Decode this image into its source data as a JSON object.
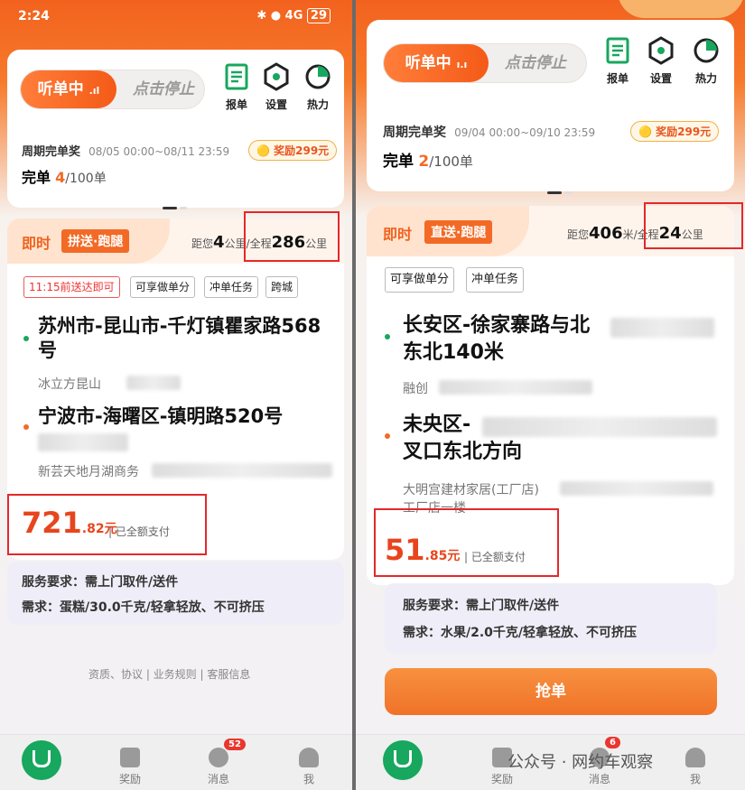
{
  "status": {
    "time": "2:24",
    "battery": "29",
    "signal": "4G"
  },
  "left": {
    "toggle": {
      "on": "听单中",
      "off": "点击停止"
    },
    "tools": [
      {
        "label": "报单",
        "icon": "report-icon"
      },
      {
        "label": "设置",
        "icon": "settings-icon"
      },
      {
        "label": "热力",
        "icon": "heatmap-icon"
      }
    ],
    "period": {
      "label": "周期完单奖",
      "range": "08/05 00:00~08/11 23:59",
      "reward": "奖励299元",
      "done_label": "完单",
      "done": "4",
      "total": "/100单"
    },
    "order": {
      "now": "即时",
      "type": "拼送·跑腿",
      "dist_prefix": "距您",
      "dist_you": "4",
      "dist_unit1": "公里/全程",
      "dist_total": "286",
      "dist_unit2": "公里",
      "tags": [
        "11:15前送达即可",
        "可享做单分",
        "冲单任务",
        "跨城"
      ],
      "from": "苏州市-昆山市-千灯镇瞿家路568号",
      "from_sub": "冰立方昆山",
      "to": "宁波市-海曙区-镇明路520号",
      "to_sub": "新芸天地月湖商务",
      "price_int": "721",
      "price_dec": ".82元",
      "paid": "已全额支付",
      "req1": "服务要求：需上门取件/送件",
      "req2": "需求：蛋糕/30.0千克/轻拿轻放、不可挤压"
    },
    "footer": "资质、协议 | 业务规则 | 客服信息",
    "tabs": {
      "reward": "奖励",
      "msg": "消息",
      "me": "我",
      "badge": "52"
    }
  },
  "right": {
    "toggle": {
      "on": "听单中",
      "off": "点击停止"
    },
    "tools": [
      {
        "label": "报单",
        "icon": "report-icon"
      },
      {
        "label": "设置",
        "icon": "settings-icon"
      },
      {
        "label": "热力",
        "icon": "heatmap-icon"
      }
    ],
    "period": {
      "label": "周期完单奖",
      "range": "09/04 00:00~09/10 23:59",
      "reward": "奖励299元",
      "done_label": "完单",
      "done": "2",
      "total": "/100单"
    },
    "order": {
      "now": "即时",
      "type": "直送·跑腿",
      "dist_prefix": "距您",
      "dist_you": "406",
      "dist_unit1": "米/全程",
      "dist_total": "24",
      "dist_unit2": "公里",
      "tags": [
        "可享做单分",
        "冲单任务"
      ],
      "from": "长安区-徐家寨路与北",
      "from2": "东北140米",
      "from_sub": "融创",
      "to": "未央区-",
      "to2": "叉口东北方向",
      "to_sub": "大明宫建材家居(工厂店)",
      "to_sub2": "工厂店一楼",
      "price_int": "51",
      "price_dec": ".85元",
      "paid": "已全额支付",
      "req1": "服务要求：需上门取件/送件",
      "req2": "需求：水果/2.0千克/轻拿轻放、不可挤压",
      "grab": "抢单"
    },
    "tabs": {
      "reward": "奖励",
      "msg": "消息",
      "me": "我",
      "badge": "6"
    },
    "watermark": "公众号 · 网约车观察"
  },
  "colors": {
    "accent": "#f26a25",
    "price": "#e8451d",
    "highlight": "#e4282a",
    "green": "#17a75e"
  }
}
